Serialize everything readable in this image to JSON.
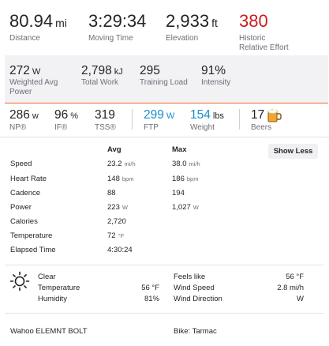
{
  "top_stats": [
    {
      "value": "80.94",
      "unit": "mi",
      "label": "Distance"
    },
    {
      "value": "3:29:34",
      "unit": "",
      "label": "Moving Time"
    },
    {
      "value": "2,933",
      "unit": "ft",
      "label": "Elevation"
    },
    {
      "value": "380",
      "unit": "",
      "label": "Historic",
      "label2": "Relative Effort"
    }
  ],
  "power_stats": [
    {
      "value": "272",
      "unit": "W",
      "label": "Weighted Avg",
      "label2": "Power"
    },
    {
      "value": "2,798",
      "unit": "kJ",
      "label": "Total Work"
    },
    {
      "value": "295",
      "unit": "",
      "label": "Training Load"
    },
    {
      "value": "91%",
      "unit": "",
      "label": "Intensity"
    }
  ],
  "metrics": [
    {
      "value": "286",
      "unit": "w",
      "label": "NP®"
    },
    {
      "value": "96",
      "unit": "%",
      "label": "IF®"
    },
    {
      "value": "319",
      "unit": "",
      "label": "TSS®"
    },
    {
      "value": "299",
      "unit": "W",
      "label": "FTP"
    },
    {
      "value": "154",
      "unit": "lbs",
      "label": "Weight"
    },
    {
      "value": "17",
      "unit": "",
      "label": "Beers"
    }
  ],
  "table": {
    "col_avg": "Avg",
    "col_max": "Max",
    "toggle_label": "Show Less",
    "rows": [
      {
        "label": "Speed",
        "avg": "23.2",
        "avg_unit": "mi/h",
        "max": "38.0",
        "max_unit": "mi/h"
      },
      {
        "label": "Heart Rate",
        "avg": "148",
        "avg_unit": "bpm",
        "max": "186",
        "max_unit": "bpm"
      },
      {
        "label": "Cadence",
        "avg": "88",
        "avg_unit": "",
        "max": "194",
        "max_unit": ""
      },
      {
        "label": "Power",
        "avg": "223",
        "avg_unit": "W",
        "max": "1,027",
        "max_unit": "W"
      },
      {
        "label": "Calories",
        "avg": "2,720",
        "avg_unit": "",
        "max": "",
        "max_unit": ""
      },
      {
        "label": "Temperature",
        "avg": "72",
        "avg_unit": "°F",
        "max": "",
        "max_unit": ""
      },
      {
        "label": "Elapsed Time",
        "avg": "4:30:24",
        "avg_unit": "",
        "max": "",
        "max_unit": ""
      }
    ]
  },
  "weather": {
    "condition": "Clear",
    "temperature_label": "Temperature",
    "temperature": "56 °F",
    "humidity_label": "Humidity",
    "humidity": "81%",
    "feels_like_label": "Feels like",
    "feels_like": "56 °F",
    "wind_speed_label": "Wind Speed",
    "wind_speed": "2.8 mi/h",
    "wind_direction_label": "Wind Direction",
    "wind_direction": "W"
  },
  "footer": {
    "device": "Wahoo ELEMNT BOLT",
    "bike": "Bike: Tarmac"
  },
  "colors": {
    "relative_effort": "#c81e1e",
    "accent_blue": "#1a8fc9",
    "orange_divider": "#f06a2d"
  }
}
